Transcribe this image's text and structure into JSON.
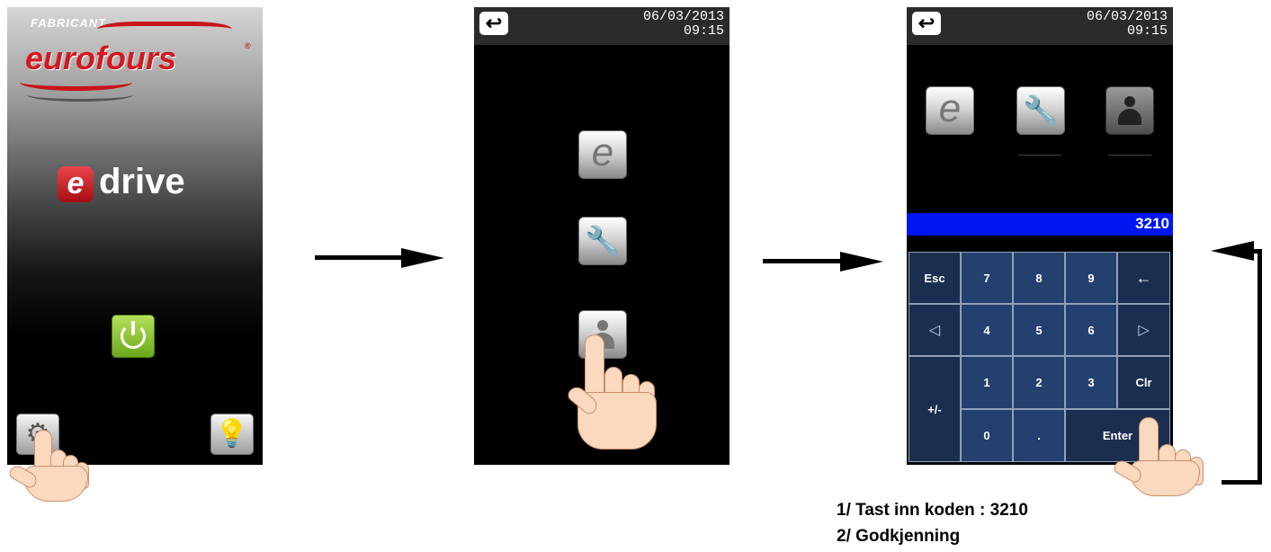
{
  "screen1": {
    "maker_label": "FABRICANT",
    "brand_name": "eurofours",
    "registered_mark": "®",
    "product_badge": "e",
    "product_name": "drive",
    "icons": [
      "power-icon",
      "gear-icon",
      "light-bulb-icon"
    ]
  },
  "screen2": {
    "back_symbol": "↩",
    "date": "06/03/2013",
    "time": "09:15",
    "menu_buttons": [
      {
        "icon": "e-logo-icon",
        "glyph": "e"
      },
      {
        "icon": "wrench-icon",
        "glyph": "🔧"
      },
      {
        "icon": "user-icon"
      }
    ]
  },
  "screen3": {
    "back_symbol": "↩",
    "date": "06/03/2013",
    "time": "09:15",
    "code_value": "3210",
    "keypad": {
      "esc": "Esc",
      "k7": "7",
      "k8": "8",
      "k9": "9",
      "backspace": "←",
      "left": "◁",
      "k4": "4",
      "k5": "5",
      "k6": "6",
      "right": "▷",
      "plusminus": "+/-",
      "k1": "1",
      "k2": "2",
      "k3": "3",
      "clr": "Clr",
      "k0": "0",
      "dot": ".",
      "enter": "Enter"
    }
  },
  "instructions": {
    "line1": "1/ Tast inn koden : 3210",
    "line2": "2/ Godkjenning"
  },
  "colors": {
    "code_bar": "#0016f0",
    "keypad_key": "#23406f",
    "power_button": "#8cc63f",
    "brand_red": "#d31820"
  }
}
